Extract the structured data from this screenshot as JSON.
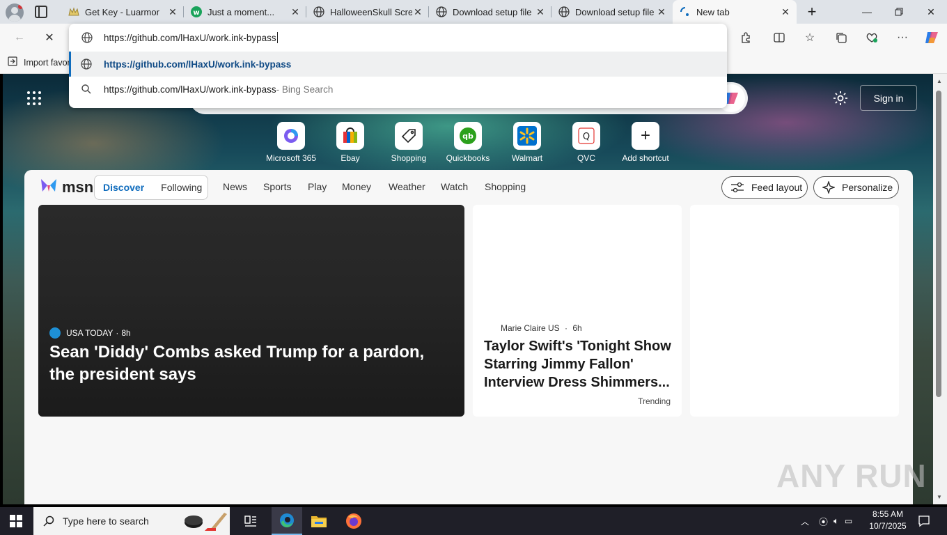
{
  "browser": {
    "tabs": [
      {
        "title": "Get Key - Luarmor",
        "icon": "luarmor-icon"
      },
      {
        "title": "Just a moment...",
        "icon": "w-logo-icon"
      },
      {
        "title": "HalloweenSkull Screen",
        "icon": "globe-icon"
      },
      {
        "title": "Download setup file",
        "icon": "globe-icon"
      },
      {
        "title": "Download setup file -",
        "icon": "globe-icon"
      },
      {
        "title": "New tab",
        "icon": "loading-icon",
        "active": true
      }
    ],
    "favorites_bar": {
      "import_label": "Import favor"
    },
    "omnibox": {
      "value": "https://github.com/lHaxU/work.ink-bypass",
      "suggestions": [
        {
          "text": "https://github.com/lHaxU/work.ink-bypass",
          "suffix": "",
          "icon": "globe-icon"
        },
        {
          "text": "https://github.com/lHaxU/work.ink-bypass",
          "suffix": " - Bing Search",
          "icon": "search-icon"
        }
      ]
    }
  },
  "newtab": {
    "signin_label": "Sign in",
    "shortcuts": [
      {
        "label": "Microsoft 365"
      },
      {
        "label": "Ebay"
      },
      {
        "label": "Shopping"
      },
      {
        "label": "Quickbooks"
      },
      {
        "label": "Walmart"
      },
      {
        "label": "QVC"
      },
      {
        "label": "Add shortcut"
      }
    ],
    "feed": {
      "logo_text": "msn",
      "toggle": [
        "Discover",
        "Following"
      ],
      "nav": [
        "News",
        "Sports",
        "Play",
        "Money",
        "Weather",
        "Watch",
        "Shopping"
      ],
      "feed_layout_label": "Feed layout",
      "personalize_label": "Personalize",
      "cards": [
        {
          "source": "USA TODAY",
          "age": "8h",
          "headline": "Sean 'Diddy' Combs asked Trump for a pardon, the president says"
        },
        {
          "source": "Marie Claire US",
          "age": "6h",
          "headline": "Taylor Swift's 'Tonight Show Starring Jimmy Fallon' Interview Dress Shimmers...",
          "tag": "Trending"
        }
      ]
    },
    "watermark": "ANY RUN"
  },
  "taskbar": {
    "search_placeholder": "Type here to search",
    "time": "8:55 AM",
    "date": "10/7/2025"
  },
  "colors": {
    "accent": "#0f6cbd",
    "taskbar": "#1f1f28"
  }
}
